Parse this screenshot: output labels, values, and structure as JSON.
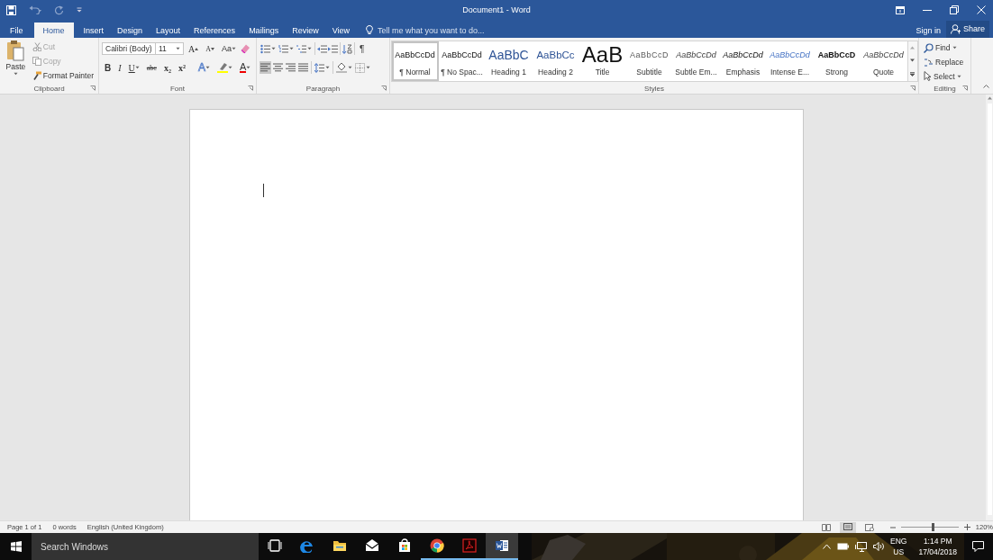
{
  "window": {
    "title": "Document1 - Word"
  },
  "tabs": [
    {
      "label": "File",
      "selected": false
    },
    {
      "label": "Home",
      "selected": true
    },
    {
      "label": "Insert",
      "selected": false
    },
    {
      "label": "Design",
      "selected": false
    },
    {
      "label": "Layout",
      "selected": false
    },
    {
      "label": "References",
      "selected": false
    },
    {
      "label": "Mailings",
      "selected": false
    },
    {
      "label": "Review",
      "selected": false
    },
    {
      "label": "View",
      "selected": false
    }
  ],
  "tell_me": {
    "placeholder": "Tell me what you want to do..."
  },
  "account": {
    "sign_in": "Sign in",
    "share": "Share"
  },
  "clipboard": {
    "label": "Clipboard",
    "paste": "Paste",
    "commands": [
      {
        "label": "Cut",
        "kind": "cut",
        "disabled": true
      },
      {
        "label": "Copy",
        "kind": "copy",
        "disabled": true
      },
      {
        "label": "Format Painter",
        "kind": "painter",
        "disabled": false
      }
    ]
  },
  "font": {
    "label": "Font",
    "name": "Calibri (Body)",
    "size": "11",
    "top_buttons": [
      {
        "label": "A",
        "kind": "grow"
      },
      {
        "label": "A",
        "kind": "shrink"
      },
      {
        "label": "Aa",
        "kind": "case"
      }
    ],
    "buttons": [
      {
        "label": "B",
        "kind": "bold"
      },
      {
        "label": "I",
        "kind": "italic"
      },
      {
        "label": "U",
        "kind": "underline"
      },
      {
        "label": "abc",
        "kind": "strike"
      },
      {
        "label": "x₂",
        "kind": "sub"
      },
      {
        "label": "x²",
        "kind": "sup"
      },
      {
        "label": "A",
        "kind": "effects"
      },
      {
        "label": "A",
        "kind": "color"
      }
    ]
  },
  "paragraph": {
    "label": "Paragraph",
    "marks": "¶",
    "alignments": [
      {
        "kind": "left",
        "selected": true
      },
      {
        "kind": "center",
        "selected": false
      },
      {
        "kind": "right",
        "selected": false
      },
      {
        "kind": "justify",
        "selected": false
      }
    ]
  },
  "styles": {
    "label": "Styles",
    "items": [
      {
        "sample": "AaBbCcDd",
        "name": "¶ Normal",
        "kind": "normal",
        "selected": true
      },
      {
        "sample": "AaBbCcDd",
        "name": "¶ No Spac...",
        "kind": "normal",
        "selected": false
      },
      {
        "sample": "AaBbC",
        "name": "Heading 1",
        "kind": "heading1",
        "selected": false
      },
      {
        "sample": "AaBbCc",
        "name": "Heading 2",
        "kind": "heading2",
        "selected": false
      },
      {
        "sample": "AaB",
        "name": "Title",
        "kind": "title",
        "selected": false
      },
      {
        "sample": "AaBbCcD",
        "name": "Subtitle",
        "kind": "subtitle",
        "selected": false
      },
      {
        "sample": "AaBbCcDd",
        "name": "Subtle Em...",
        "kind": "subtle",
        "selected": false
      },
      {
        "sample": "AaBbCcDd",
        "name": "Emphasis",
        "kind": "emphasis",
        "selected": false
      },
      {
        "sample": "AaBbCcDd",
        "name": "Intense E...",
        "kind": "intense",
        "selected": false
      },
      {
        "sample": "AaBbCcD",
        "name": "Strong",
        "kind": "strong",
        "selected": false
      },
      {
        "sample": "AaBbCcDd",
        "name": "Quote",
        "kind": "subtle",
        "selected": false
      }
    ]
  },
  "editing": {
    "label": "Editing",
    "find": "Find",
    "replace": "Replace",
    "select": "Select"
  },
  "status": {
    "page": "Page 1 of 1",
    "words": "0 words",
    "language": "English (United Kingdom)",
    "zoom": {
      "level": 0.55,
      "reading": "120%"
    }
  },
  "taskbar": {
    "search": {
      "placeholder": "Search Windows"
    },
    "apps": [
      {
        "kind": "taskview",
        "running": false,
        "selected": false
      },
      {
        "kind": "edge",
        "running": false,
        "selected": false
      },
      {
        "kind": "folder",
        "running": false,
        "selected": false
      },
      {
        "kind": "mail",
        "running": false,
        "selected": false
      },
      {
        "kind": "store",
        "running": false,
        "selected": false
      },
      {
        "kind": "chrome",
        "running": true,
        "selected": false
      },
      {
        "kind": "acrobat",
        "running": true,
        "selected": false
      },
      {
        "kind": "word",
        "running": true,
        "selected": true
      }
    ],
    "language": "ENG",
    "region": "US",
    "time": "1:14 PM",
    "date": "17/04/2018"
  }
}
